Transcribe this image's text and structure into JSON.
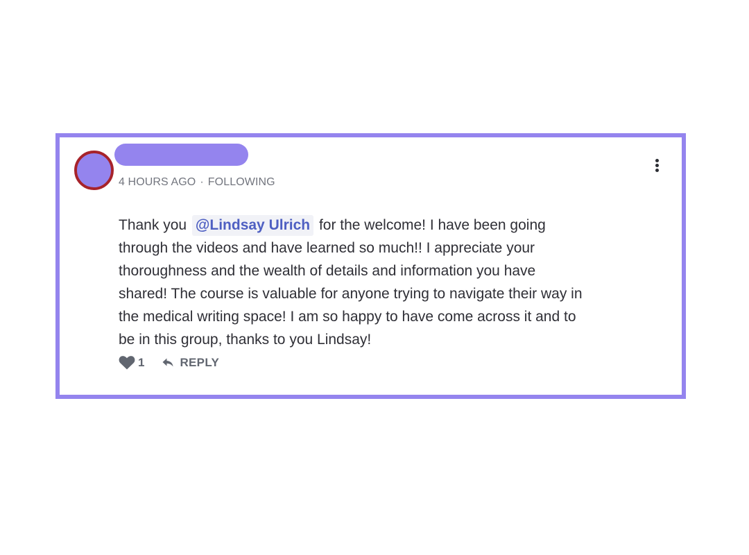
{
  "comment": {
    "timestamp": "4 HOURS AGO",
    "separator": "·",
    "follow_status": "FOLLOWING",
    "mention": "@Lindsay Ulrich",
    "text_before_mention": "Thank you",
    "lines": [
      "for the welcome! I have been going",
      "through the videos and have learned so much!! I appreciate your",
      "thoroughness and the wealth of details and information you have",
      "shared! The course is valuable for anyone trying to navigate their way in",
      "the medical writing space! I am so happy to have come across it and to",
      "be in this group, thanks to you Lindsay!"
    ],
    "like_count": "1",
    "reply_label": "REPLY"
  },
  "icons": {
    "more": "more-vertical-icon",
    "like": "heart-icon",
    "reply": "reply-arrow-icon"
  },
  "colors": {
    "accent_border": "#9484ee",
    "avatar_ring": "#a7232b",
    "mention_text": "#4e5fc2",
    "mention_bg": "#f1f2f7"
  }
}
